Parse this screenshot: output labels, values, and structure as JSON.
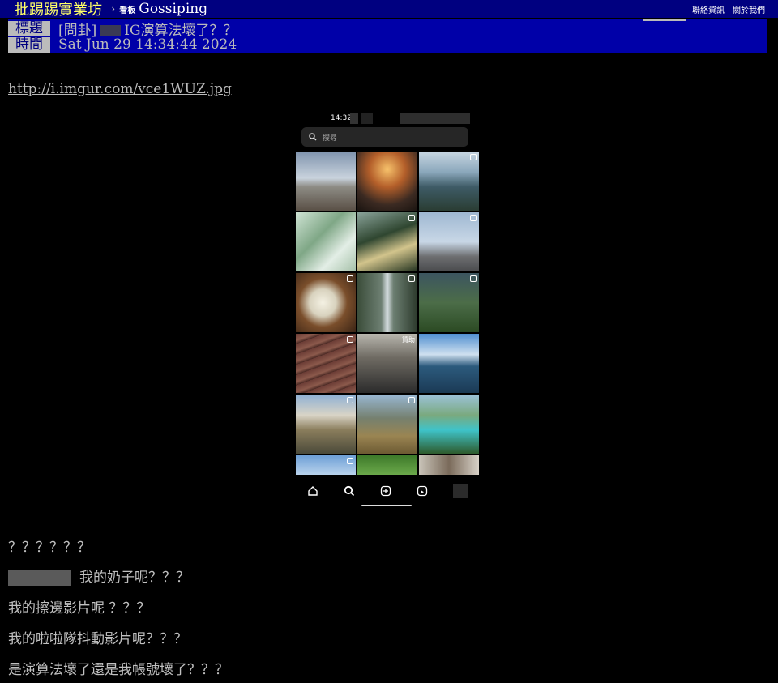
{
  "nav": {
    "site_name": "批踢踢實業坊",
    "separator": "›",
    "board_tag": "看板",
    "board_name": "Gossiping",
    "links": [
      "聯絡資訊",
      "關於我們"
    ]
  },
  "header": {
    "title_label": "標題",
    "title_value_prefix": "[問卦]",
    "title_value_suffix": "IG演算法壞了？？",
    "time_label": "時間",
    "time_value": "Sat Jun 29 14:34:44 2024"
  },
  "post": {
    "link": "http://i.imgur.com/vce1WUZ.jpg",
    "lines": [
      "？？？？？？",
      "我的奶子呢？？？",
      "我的擦邊影片呢  ？？？",
      "我的啦啦隊抖動影片呢？？？",
      "是演算法壞了還是我帳號壞了？？？"
    ]
  },
  "phone": {
    "time": "14:32",
    "search_placeholder": "搜尋",
    "tile_tag": "贊助",
    "nav_icons": [
      "home-icon",
      "search-icon",
      "add-icon",
      "reels-icon",
      "profile-icon"
    ],
    "tiles": [
      "beach-rock",
      "mountain-sunset",
      "lake-mountains",
      "bamboo-interior",
      "forest-tent",
      "cyclist-road",
      "plate-dish",
      "waterfall",
      "mountain-biker",
      "leather-wallet",
      "street-crowd",
      "kayak-sea",
      "mountain-reflection",
      "valley-meadow",
      "turquoise-lake",
      "sky-clouds",
      "green-foliage",
      "group-portrait"
    ]
  }
}
